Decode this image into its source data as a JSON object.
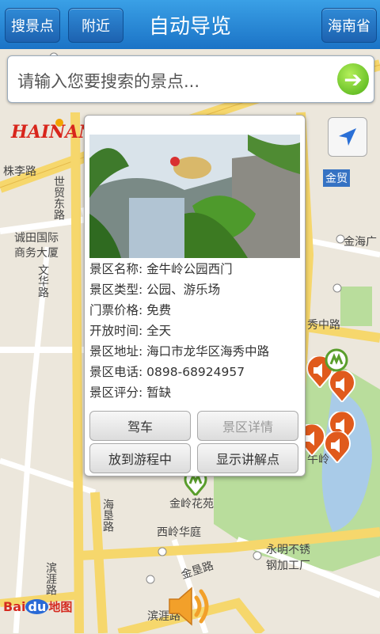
{
  "header": {
    "search_scenic_button": "搜景点",
    "nearby_button": "附近",
    "title": "自动导览",
    "province_button": "海南省"
  },
  "search": {
    "placeholder": "请输入您要搜索的景点..."
  },
  "logo": {
    "text": "HAINAN"
  },
  "map_labels": {
    "zhuli_road": "株李路",
    "shimao_east_road": "世贸东路",
    "jinmao": "金贸",
    "jinhai": "金海广",
    "chengtian_1": "诚田国际",
    "chengtian_2": "商务大厦",
    "wenhua_road": "文华路",
    "haixiu_road": "秀中路",
    "haiken_road": "海垦路",
    "jinling_garden": "金岭花苑",
    "xiling": "西岭华庭",
    "yongming_1": "永明不锈",
    "yongming_2": "钢加工厂",
    "jinken_road": "金垦路",
    "binya_road": "滨涯路",
    "binyajia": "滨涯路",
    "jinniu": "牛岭"
  },
  "popup": {
    "name_label": "景区名称:",
    "name_value": "金牛岭公园西门",
    "type_label": "景区类型:",
    "type_value": "公园、游乐场",
    "ticket_label": "门票价格:",
    "ticket_value": "免费",
    "hours_label": "开放时间:",
    "hours_value": "全天",
    "address_label": "景区地址:",
    "address_value": "海口市龙华区海秀中路",
    "phone_label": "景区电话:",
    "phone_value": "0898-68924957",
    "rating_label": "景区评分:",
    "rating_value": "暂缺",
    "drive_button": "驾车",
    "details_button": "景区详情",
    "add_itinerary_button": "放到游程中",
    "show_narration_button": "显示讲解点"
  },
  "baidu": {
    "bai": "Bai",
    "du": "du",
    "map": "地图"
  },
  "colors": {
    "header": "#1b73c6",
    "road_yellow": "#f6d76c",
    "park_green": "#b9dd9c",
    "water": "#a9cbe8",
    "marker": "#e05a1c"
  }
}
